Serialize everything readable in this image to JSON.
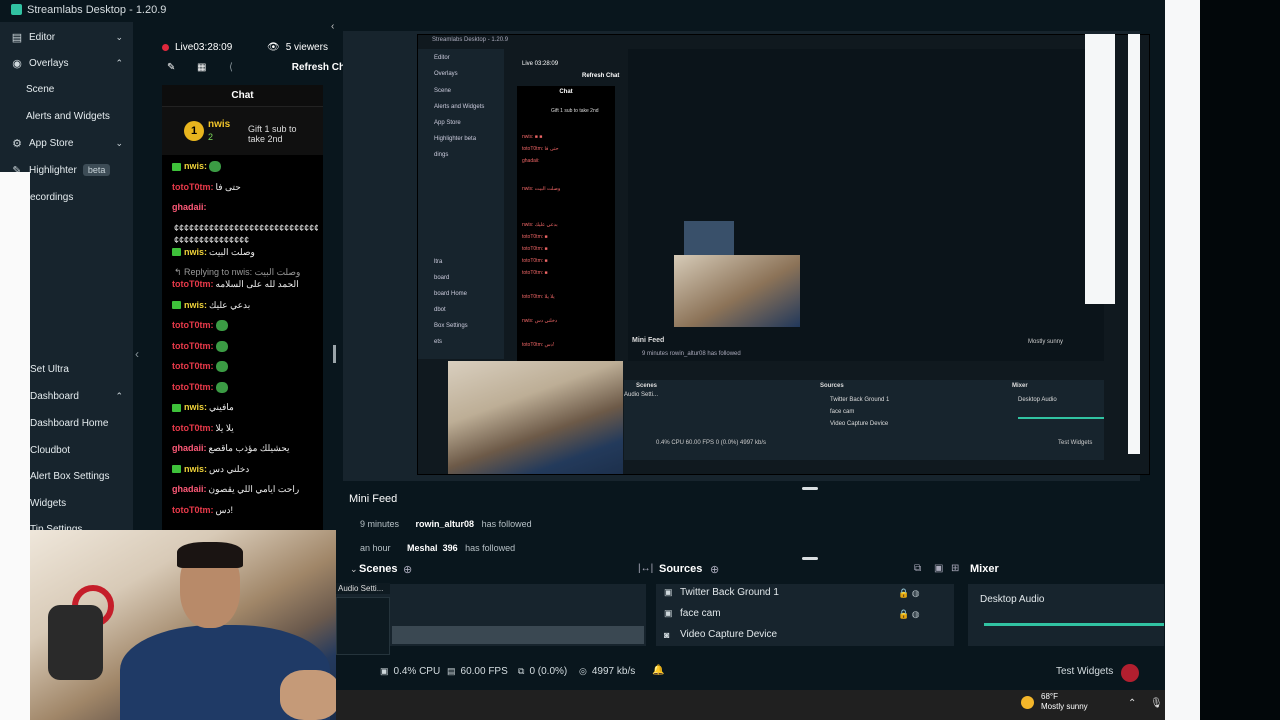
{
  "window": {
    "title": "Streamlabs Desktop - 1.20.9"
  },
  "sidebar": {
    "items": [
      {
        "label": "Editor",
        "icon": "editor-icon"
      },
      {
        "label": "Overlays",
        "icon": "overlays-icon"
      },
      {
        "label": "Scene"
      },
      {
        "label": "Alerts and Widgets"
      },
      {
        "label": "App Store",
        "icon": "store-icon"
      },
      {
        "label": "Highlighter",
        "icon": "highlighter-icon",
        "badge": "beta"
      },
      {
        "label": "ecordings"
      },
      {
        "label": "Set Ultra"
      },
      {
        "label": "Dashboard"
      },
      {
        "label": "Dashboard Home"
      },
      {
        "label": "Cloudbot"
      },
      {
        "label": "Alert Box Settings"
      },
      {
        "label": "Widgets"
      },
      {
        "label": "Tip Settings"
      }
    ]
  },
  "chat": {
    "live": "Live",
    "time": "03:28:09",
    "viewers": "5 viewers",
    "refresh_label": "Refresh Chat",
    "title": "Chat",
    "banner": {
      "medal": "1",
      "name": "nwis",
      "count": "2",
      "text": "Gift 1 sub to take 2nd"
    },
    "messages": [
      {
        "user": "nwis:",
        "text": "",
        "color": "green",
        "badge": true,
        "emote": true
      },
      {
        "user": "totoT0tm:",
        "text": "حتى فا",
        "color": "red"
      },
      {
        "user": "ghadaii:",
        "text": "",
        "color": "pink"
      },
      {
        "user": "",
        "text": "¢¢¢¢¢¢¢¢¢¢¢¢¢¢¢¢¢¢¢¢¢¢¢¢¢¢¢¢¢¢¢¢",
        "color": "none"
      },
      {
        "user": "",
        "text": "¢¢¢¢¢¢¢¢¢¢¢¢¢¢¢",
        "color": "none"
      },
      {
        "user": "nwis:",
        "text": "وصلت البيت",
        "color": "green",
        "badge": true
      },
      {
        "user": "",
        "text": "↰ Replying to nwis: وصلت البيت",
        "color": "reply"
      },
      {
        "user": "totoT0tm:",
        "text": "الحمد لله على السلامه",
        "color": "red"
      },
      {
        "user": "nwis:",
        "text": "بدعي عليك",
        "color": "green",
        "badge": true
      },
      {
        "user": "totoT0tm:",
        "text": "",
        "color": "red",
        "emote": true
      },
      {
        "user": "totoT0tm:",
        "text": "",
        "color": "red",
        "emote": true
      },
      {
        "user": "totoT0tm:",
        "text": "",
        "color": "red",
        "emote": true
      },
      {
        "user": "totoT0tm:",
        "text": "",
        "color": "red",
        "emote": true
      },
      {
        "user": "nwis:",
        "text": "مافيني",
        "color": "green",
        "badge": true
      },
      {
        "user": "totoT0tm:",
        "text": "يلا يلا",
        "color": "red"
      },
      {
        "user": "ghadaii:",
        "text": "يحشيلك مؤذب ماقصع",
        "color": "pink"
      },
      {
        "user": "nwis:",
        "text": "دخلني دس",
        "color": "green",
        "badge": true
      },
      {
        "user": "ghadaii:",
        "text": "راحت ايامي اللي يقصون",
        "color": "pink"
      },
      {
        "user": "totoT0tm:",
        "text": "دس!",
        "color": "red"
      }
    ]
  },
  "inner": {
    "title": "Streamlabs Desktop - 1.20.9",
    "sidebar": [
      "Editor",
      "Overlays",
      "Scene",
      "Alerts and Widgets",
      "App Store",
      "Highlighter beta",
      "dings",
      "ltra",
      "board",
      "board Home",
      "dbot",
      "Box Settings",
      "ets"
    ],
    "chat_live": "Live 03:28:09",
    "chat_refresh": "Refresh Chat",
    "chat_title": "Chat",
    "chat_banner": "Gift 1 sub to take 2nd",
    "mini_feed": "Mini Feed",
    "feed_row": "9 minutes   rowin_altur08   has followed",
    "scenes": "Scenes",
    "sources": "Sources",
    "mixer": "Mixer",
    "sources_list": [
      "Twitter Back Ground 1",
      "face cam",
      "Video Capture Device"
    ],
    "desktop_audio": "Desktop Audio",
    "audio_settings": "Audio Setti...",
    "status": "0.4% CPU   60.00 FPS   0 (0.0%)   4997 kb/s",
    "test_widgets": "Test Widgets",
    "weather": "Mostly sunny"
  },
  "mini_feed": {
    "title": "Mini Feed",
    "rows": [
      {
        "time": "9 minutes",
        "user": "rowin_altur08",
        "action": "has followed"
      },
      {
        "time": "an hour",
        "user": "Meshal_396",
        "action": "has followed"
      }
    ]
  },
  "scenes": {
    "title": "Scenes"
  },
  "sources": {
    "title": "Sources",
    "items": [
      {
        "label": "Twitter Back Ground 1",
        "icon": "image-icon"
      },
      {
        "label": "face cam",
        "icon": "image-icon"
      },
      {
        "label": "Video Capture Device",
        "icon": "camera-icon"
      }
    ]
  },
  "mixer": {
    "title": "Mixer",
    "items": [
      {
        "label": "Desktop Audio",
        "level": 1.0
      }
    ],
    "accent": "#31c3a2"
  },
  "webcam": {
    "audio_label": "Audio Setti..."
  },
  "status": {
    "cpu": "0.4% CPU",
    "fps": "60.00 FPS",
    "dropped": "0 (0.0%)",
    "bitrate": "4997 kb/s",
    "test_widgets": "Test Widgets"
  },
  "taskbar": {
    "temp": "68°F",
    "weather": "Mostly sunny",
    "lang": "ع"
  },
  "colors": {
    "accent": "#31c3a2",
    "live": "#e0283c",
    "sidebar_bg": "#17242d",
    "app_bg": "#09161d"
  }
}
